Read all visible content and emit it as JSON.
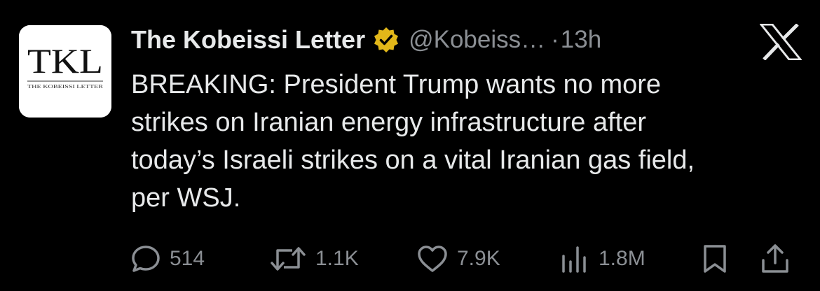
{
  "author": {
    "name": "The Kobeissi Letter",
    "handle": "@Kobeiss…",
    "separator": "·",
    "time": "13h",
    "verified_badge_color": "#e2b719",
    "avatar": {
      "monogram": "TKL",
      "subtitle": "THE KOBEISSI LETTER"
    }
  },
  "platform_icon": "x-logo-icon",
  "tweet": {
    "lines": [
      "BREAKING: President Trump wants no more",
      "strikes on Iranian energy infrastructure after",
      "today’s Israeli strikes on a vital Iranian gas field,",
      "per WSJ."
    ]
  },
  "actions": {
    "reply": {
      "icon": "reply-icon",
      "count": "514"
    },
    "retweet": {
      "icon": "retweet-icon",
      "count": "1.1K"
    },
    "like": {
      "icon": "heart-icon",
      "count": "7.9K"
    },
    "views": {
      "icon": "views-icon",
      "count": "1.8M"
    },
    "bookmark": {
      "icon": "bookmark-icon"
    },
    "share": {
      "icon": "share-icon"
    }
  },
  "colors": {
    "background": "#000000",
    "text": "#e7e9ea",
    "muted": "#8b8f94"
  }
}
